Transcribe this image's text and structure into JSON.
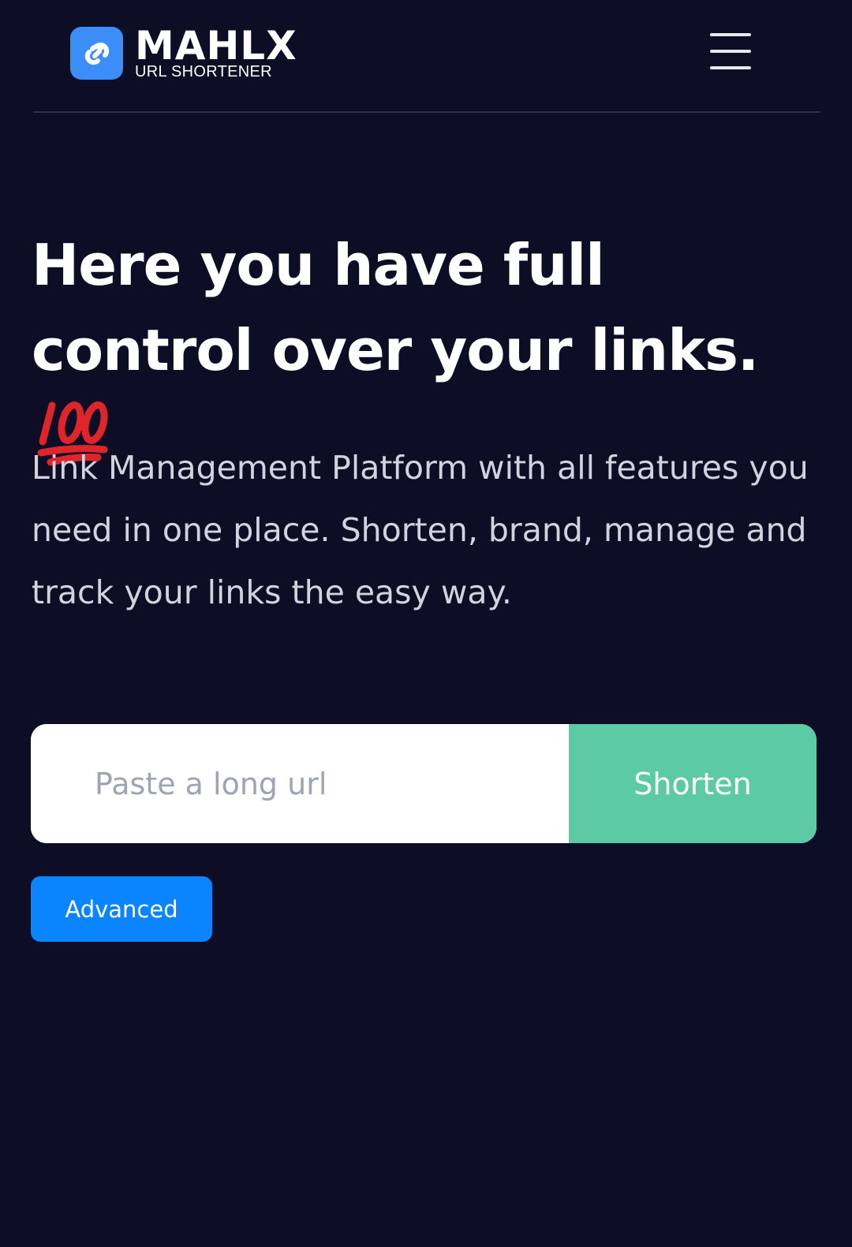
{
  "header": {
    "brand_name": "MAHLX",
    "brand_tagline": "URL SHORTENER",
    "logo_icon": "link-icon",
    "menu_icon": "hamburger-menu-icon"
  },
  "hero": {
    "headline": "Here you have full control over your links.",
    "headline_emoji": "hundred-points-emoji",
    "description": "Link Management Platform with all features you need in one place. Shorten, brand, manage and track your links the easy way."
  },
  "shorten_form": {
    "input_value": "",
    "input_placeholder": "Paste a long url",
    "submit_label": "Shorten"
  },
  "advanced_label": "Advanced",
  "colors": {
    "background": "#0d0d26",
    "logo_accent": "#3b8ef7",
    "shorten_button": "#5ccaa5",
    "advanced_button": "#0a84ff"
  }
}
